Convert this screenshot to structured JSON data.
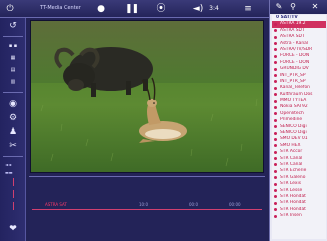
{
  "app": {
    "title": "TT-Media Center"
  },
  "colors": {
    "panel": "#232356",
    "accent": "#d04070",
    "list_text": "#c01848"
  },
  "toolbar": {
    "icons": [
      "power-icon",
      "back-icon",
      "record-icon",
      "pause-icon",
      "play-icon",
      "volume-icon",
      "menu-icon"
    ],
    "volume_label": "◄)",
    "ratio_label": "3:4"
  },
  "status": {
    "channel_label": "ASTRA SAT",
    "values": [
      "10:0",
      "00:0",
      "00:00"
    ]
  },
  "channel_list": {
    "group": "0 SAT/TV",
    "items": [
      "ASTRA 19.2",
      "ASTRA SDT",
      "ASTRA SDT",
      "Astra - Kanal",
      "ASTRA/TV/SDR",
      "FORCE - DON",
      "FORCE - DON",
      "GRUNDIG DV",
      "INT_PTR_SP",
      "INT_PTR_SP",
      "Kanal_Telefon",
      "Kulthraum Dos",
      "MMO TYTEA",
      "Nokia SAT92",
      "Openlitech",
      "Primedine",
      "SENICO Digi",
      "SENICO Digi",
      "SMO DEV 01",
      "SMO HEX",
      "STR Accor",
      "STR Canal",
      "STR Canal",
      "STR Echerie",
      "STR Galeno",
      "STR Lexis",
      "STR Lesse",
      "STR Hondat",
      "STR Hondat",
      "STR Hondat",
      "STR Insen"
    ]
  }
}
